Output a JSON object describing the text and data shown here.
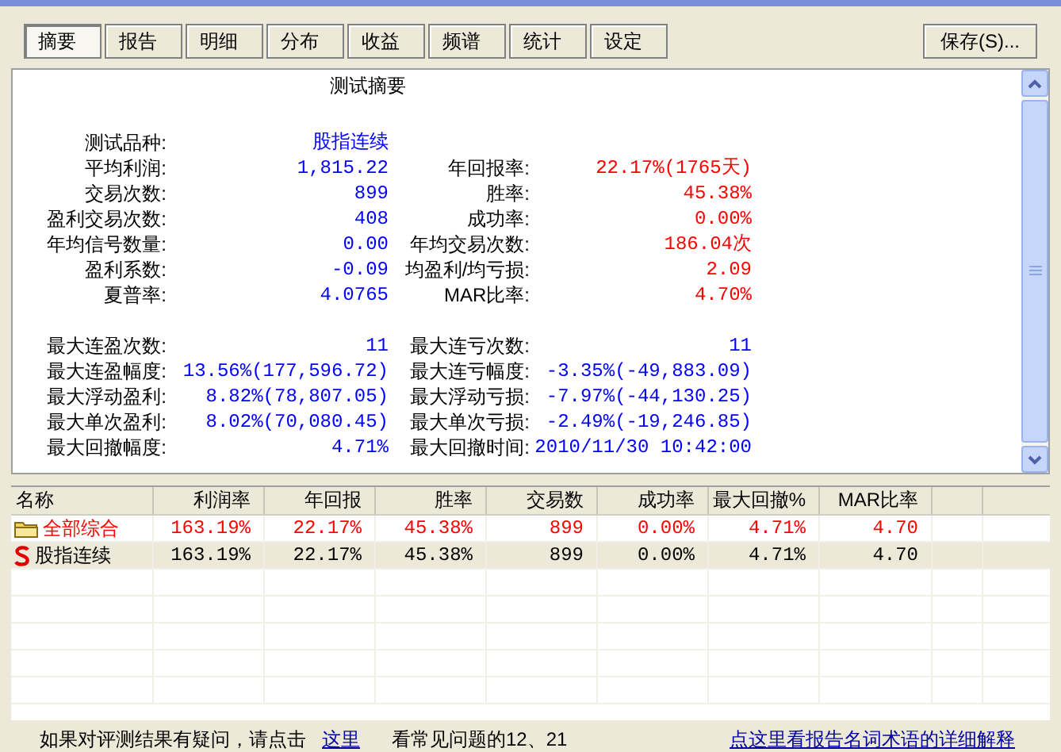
{
  "tabs": [
    {
      "label": "摘要",
      "selected": true
    },
    {
      "label": "报告",
      "selected": false
    },
    {
      "label": "明细",
      "selected": false
    },
    {
      "label": "分布",
      "selected": false
    },
    {
      "label": "收益",
      "selected": false
    },
    {
      "label": "频谱",
      "selected": false
    },
    {
      "label": "统计",
      "selected": false
    },
    {
      "label": "设定",
      "selected": false
    }
  ],
  "save_button": "保存(S)...",
  "summary": {
    "title": "测试摘要",
    "sections": [
      {
        "rows": [
          {
            "left": {
              "label": "测试品种:",
              "value": "股指连续",
              "color": "#0000ff"
            }
          },
          {
            "left": {
              "label": "平均利润:",
              "value": "1,815.22",
              "color": "#0000ff"
            },
            "right": {
              "label": "年回报率:",
              "value": "22.17%(1765天)",
              "color": "#ff0000"
            }
          },
          {
            "left": {
              "label": "交易次数:",
              "value": "899",
              "color": "#0000ff"
            },
            "right": {
              "label": "胜率:",
              "value": "45.38%",
              "color": "#ff0000"
            }
          },
          {
            "left": {
              "label": "盈利交易次数:",
              "value": "408",
              "color": "#0000ff"
            },
            "right": {
              "label": "成功率:",
              "value": "0.00%",
              "color": "#ff0000"
            }
          },
          {
            "left": {
              "label": "年均信号数量:",
              "value": "0.00",
              "color": "#0000ff"
            },
            "right": {
              "label": "年均交易次数:",
              "value": "186.04次",
              "color": "#ff0000"
            }
          },
          {
            "left": {
              "label": "盈利系数:",
              "value": "-0.09",
              "color": "#0000ff"
            },
            "right": {
              "label": "均盈利/均亏损:",
              "value": "2.09",
              "color": "#ff0000"
            }
          },
          {
            "left": {
              "label": "夏普率:",
              "value": "4.0765",
              "color": "#0000ff"
            },
            "right": {
              "label": "MAR比率:",
              "value": "4.70%",
              "color": "#ff0000"
            }
          }
        ]
      },
      {
        "rows": [
          {
            "left": {
              "label": "最大连盈次数:",
              "value": "11",
              "color": "#0000ff"
            },
            "right": {
              "label": "最大连亏次数:",
              "value": "11",
              "color": "#0000ff"
            }
          },
          {
            "left": {
              "label": "最大连盈幅度:",
              "value": "13.56%(177,596.72)",
              "color": "#0000ff"
            },
            "right": {
              "label": "最大连亏幅度:",
              "value": "-3.35%(-49,883.09)",
              "color": "#0000ff"
            }
          },
          {
            "left": {
              "label": "最大浮动盈利:",
              "value": "8.82%(78,807.05)",
              "color": "#0000ff"
            },
            "right": {
              "label": "最大浮动亏损:",
              "value": "-7.97%(-44,130.25)",
              "color": "#0000ff"
            }
          },
          {
            "left": {
              "label": "最大单次盈利:",
              "value": "8.02%(70,080.45)",
              "color": "#0000ff"
            },
            "right": {
              "label": "最大单次亏损:",
              "value": "-2.49%(-19,246.85)",
              "color": "#0000ff"
            }
          },
          {
            "left": {
              "label": "最大回撤幅度:",
              "value": "4.71%",
              "color": "#0000ff"
            },
            "right": {
              "label": "最大回撤时间:",
              "value": "2010/11/30 10:42:00",
              "color": "#0000ff"
            }
          }
        ]
      }
    ]
  },
  "table": {
    "columns": [
      "名称",
      "利润率",
      "年回报",
      "胜率",
      "交易数",
      "成功率",
      "最大回撤%",
      "MAR比率"
    ],
    "rows": [
      {
        "kind": "folder",
        "selected": false,
        "color": "#ff0000",
        "cells": [
          "全部综合",
          "163.19%",
          "22.17%",
          "45.38%",
          "899",
          "0.00%",
          "4.71%",
          "4.70"
        ]
      },
      {
        "kind": "strategy",
        "selected": true,
        "color": "#000000",
        "cells": [
          "股指连续",
          "163.19%",
          "22.17%",
          "45.38%",
          "899",
          "0.00%",
          "4.71%",
          "4.70"
        ]
      }
    ]
  },
  "footer": {
    "text": "如果对评测结果有疑问，请点击",
    "link": "这里",
    "note": "看常见问题的12、21",
    "help_link": "点这里看报告名词术语的详细解释"
  }
}
